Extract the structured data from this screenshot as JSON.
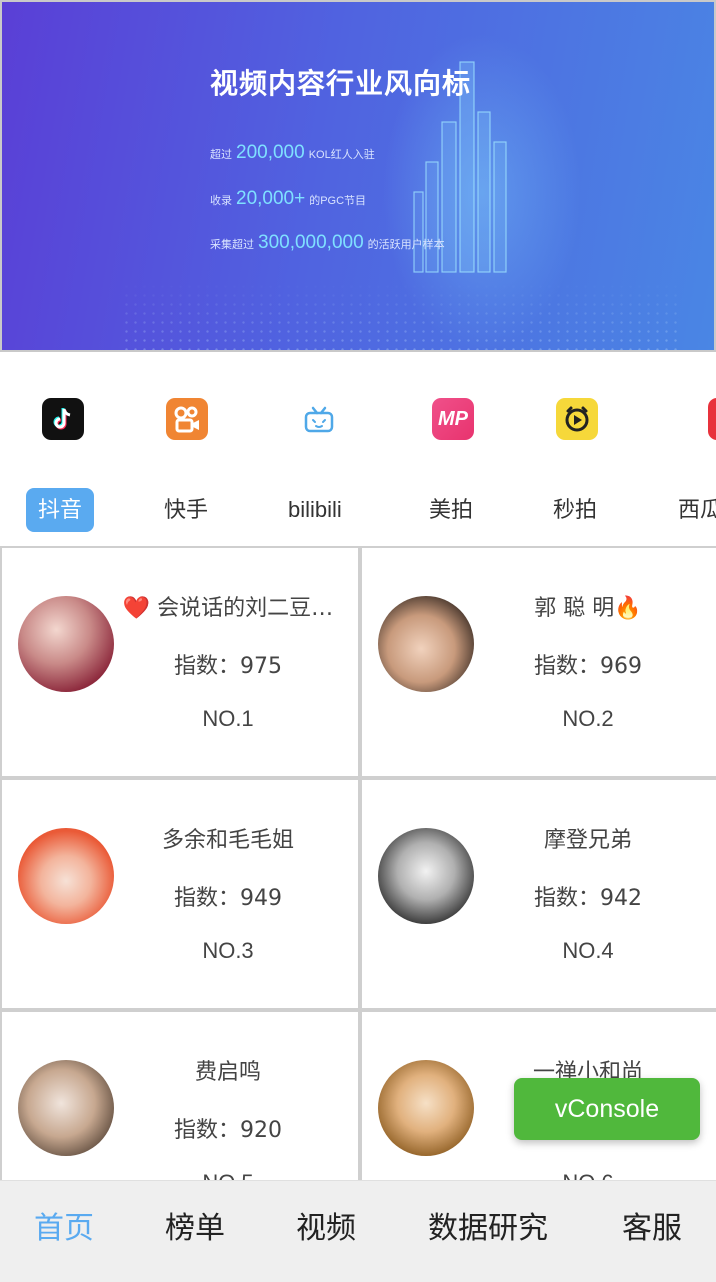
{
  "banner": {
    "title": "视频内容行业风向标",
    "stats": [
      {
        "prefix": "超过",
        "value": "200,000",
        "suffix": "KOL红人入驻"
      },
      {
        "prefix": "收录",
        "value": "20,000+",
        "suffix": "的PGC节目"
      },
      {
        "prefix": "采集超过",
        "value": "300,000,000",
        "suffix": "的活跃用户样本"
      }
    ]
  },
  "platforms": [
    {
      "icon": "douyin-icon",
      "label": "抖音",
      "active": true
    },
    {
      "icon": "kuaishou-icon",
      "label": "快手",
      "active": false
    },
    {
      "icon": "bilibili-icon",
      "label": "bilibili",
      "active": false
    },
    {
      "icon": "meipai-icon",
      "label": "美拍",
      "active": false
    },
    {
      "icon": "miaopai-icon",
      "label": "秒拍",
      "active": false
    },
    {
      "icon": "xigua-icon",
      "label": "西瓜",
      "active": false
    }
  ],
  "ranking": [
    {
      "name": "❤️ 会说话的刘二豆…",
      "score": "指数：975",
      "rank": "NO.1"
    },
    {
      "name": "郭 聪 明🔥",
      "score": "指数：969",
      "rank": "NO.2"
    },
    {
      "name": "多余和毛毛姐",
      "score": "指数：949",
      "rank": "NO.3"
    },
    {
      "name": "摩登兄弟",
      "score": "指数：942",
      "rank": "NO.4"
    },
    {
      "name": "费启鸣",
      "score": "指数：920",
      "rank": "NO.5"
    },
    {
      "name": "一禅小和尚",
      "score": "",
      "rank": "NO.6"
    }
  ],
  "vconsole": {
    "label": "vConsole"
  },
  "bottom_nav": [
    {
      "label": "首页",
      "active": true
    },
    {
      "label": "榜单",
      "active": false
    },
    {
      "label": "视频",
      "active": false
    },
    {
      "label": "数据研究",
      "active": false
    },
    {
      "label": "客服",
      "active": false
    }
  ],
  "colors": {
    "accent": "#5aaaf0",
    "vconsole": "#50b83c",
    "banner_start": "#5a3fd6",
    "banner_end": "#4a86e4"
  }
}
